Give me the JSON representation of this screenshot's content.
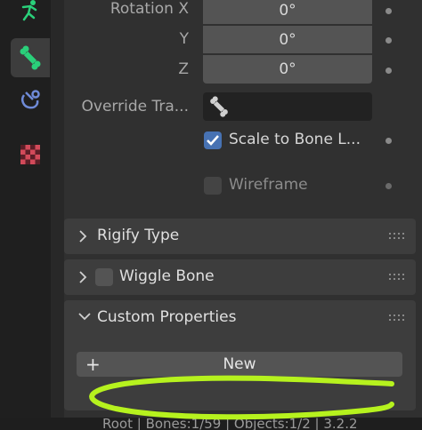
{
  "properties": {
    "rotation_x_label": "Rotation X",
    "rotation_x_value": "0°",
    "y_label": "Y",
    "y_value": "0°",
    "z_label": "Z",
    "z_value": "0°",
    "override_label": "Override Tra...",
    "scale_to_bone_label": "Scale to Bone L...",
    "scale_to_bone_checked": true,
    "wireframe_label": "Wireframe",
    "wireframe_checked": false
  },
  "sections": {
    "rigify": "Rigify Type",
    "wiggle": "Wiggle Bone",
    "custom_props": "Custom Properties"
  },
  "custom_properties": {
    "new_label": "New",
    "plus_icon": "+"
  },
  "statusbar": {
    "text": "Root | Bones:1/59 | Objects:1/2 | 3.2.2"
  },
  "colors": {
    "accent_blue": "#4772b3",
    "scribble": "#b6f21e",
    "bone_icon": "#2ad07a"
  },
  "tab_icons": [
    "bone-constraint-icon",
    "bone-icon",
    "constraint-icon",
    "texture-icon"
  ]
}
